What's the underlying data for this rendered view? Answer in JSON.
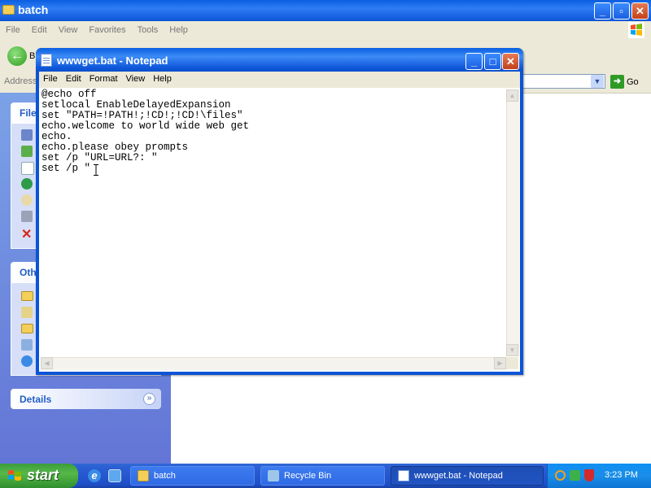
{
  "explorer": {
    "title": "batch",
    "menu": [
      "File",
      "Edit",
      "View",
      "Favorites",
      "Tools",
      "Help"
    ],
    "back_label": "B",
    "address_label": "Address",
    "go_label": "Go",
    "task_pane": {
      "file_tasks_title": "File",
      "other_places_title": "Oth",
      "details_title": "Details"
    }
  },
  "notepad": {
    "title": "wwwget.bat - Notepad",
    "menu": [
      "File",
      "Edit",
      "Format",
      "View",
      "Help"
    ],
    "content": "@echo off\nsetlocal EnableDelayedExpansion\nset \"PATH=!PATH!;!CD!;!CD!\\files\"\necho.welcome to world wide web get\necho.\necho.please obey prompts\nset /p \"URL=URL?: \"\nset /p \""
  },
  "taskbar": {
    "start_label": "start",
    "tasks": [
      {
        "label": "batch",
        "icon": "folder-icon"
      },
      {
        "label": "Recycle Bin",
        "icon": "recycle-bin-icon"
      },
      {
        "label": "wwwget.bat - Notepad",
        "icon": "notepad-icon",
        "active": true
      }
    ],
    "clock": "3:23 PM"
  },
  "colors": {
    "title_blue": "#0a5fe0",
    "taskbar_blue": "#2b5fd4",
    "start_green": "#3b9d3b",
    "pane_blue": "#7ba2e7",
    "menu_bg": "#ece9d8"
  }
}
